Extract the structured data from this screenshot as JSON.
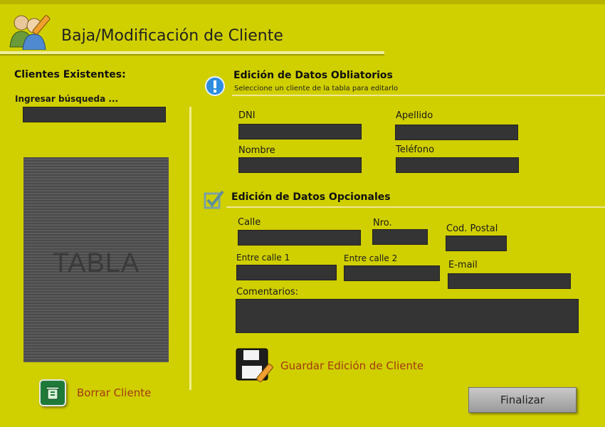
{
  "window": {
    "title": "Baja/Modificación de Cliente"
  },
  "left_panel": {
    "heading": "Clientes Existentes:",
    "search_label": "Ingresar búsqueda ...",
    "table_placeholder": "TABLA",
    "delete_label": "Borrar Cliente"
  },
  "required_section": {
    "title": "Edición de Datos Obliatorios",
    "subtitle": "Seleccione un cliente de la tabla para editarlo",
    "labels": {
      "dni": "DNI",
      "apellido": "Apellido",
      "nombre": "Nombre",
      "telefono": "Teléfono"
    }
  },
  "optional_section": {
    "title": "Edición de Datos Opcionales",
    "labels": {
      "calle": "Calle",
      "nro": "Nro.",
      "cod_postal": "Cod. Postal",
      "entre1": "Entre calle 1",
      "entre2": "Entre calle 2",
      "email": "E-mail",
      "comentarios": "Comentarios:"
    }
  },
  "actions": {
    "save_label": "Guardar Edición de Cliente",
    "finish_label": "Finalizar"
  },
  "colors": {
    "background": "#d0cf00",
    "field": "#343434",
    "link": "#a23b16"
  },
  "icons": [
    "users-edit-icon",
    "info-icon",
    "checkbox-icon",
    "recycle-bin-icon",
    "floppy-edit-icon"
  ]
}
